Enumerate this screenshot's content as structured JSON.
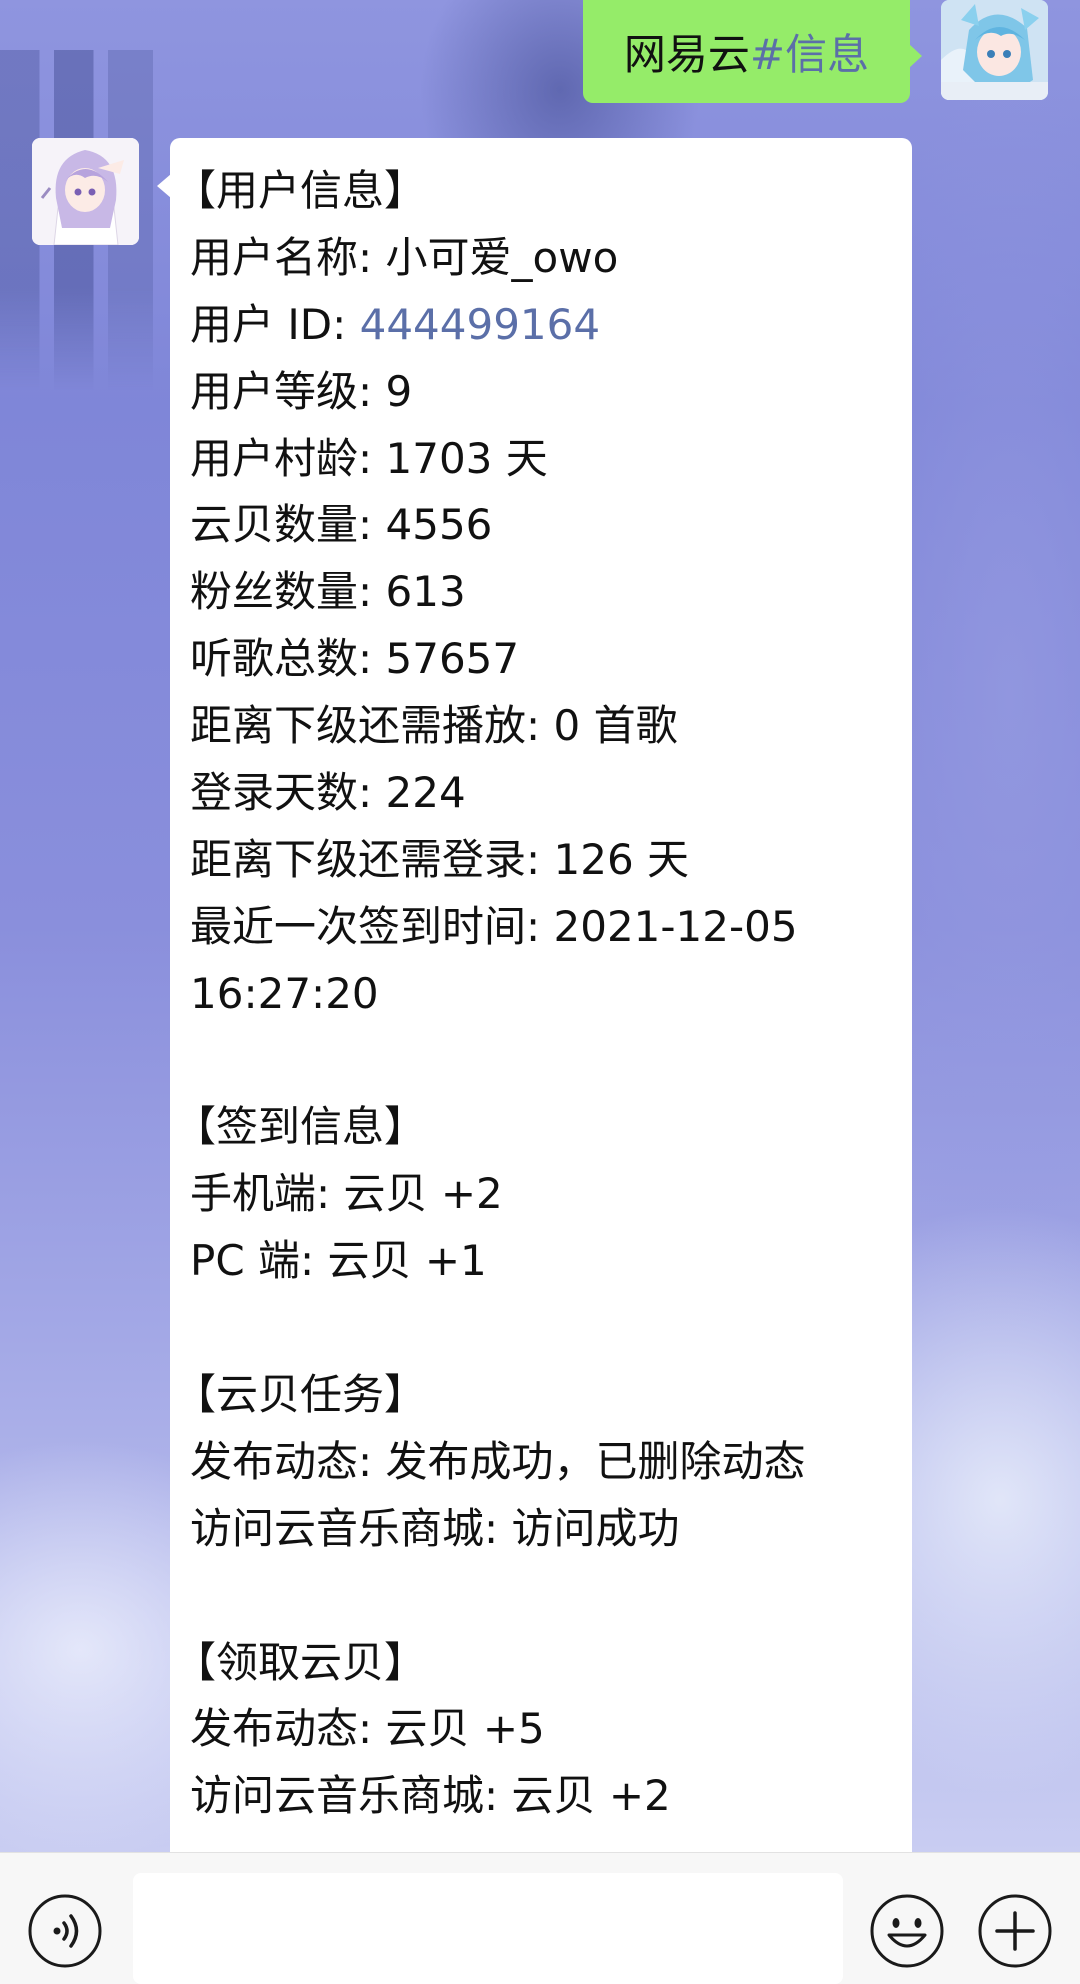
{
  "chat": {
    "outgoing": {
      "prefix": "网易云",
      "hashtag": "#信息"
    },
    "reply": {
      "user_info_header": "【用户信息】",
      "username_label": "用户名称: ",
      "username": "小可爱_owo",
      "user_id_label": "用户 ID: ",
      "user_id": "444499164",
      "level": "用户等级: 9",
      "account_age": "用户村龄: 1703 天",
      "cloud_shells": "云贝数量: 4556",
      "followers": "粉丝数量: 613",
      "total_listens": "听歌总数: 57657",
      "plays_to_next_level": "距离下级还需播放: 0 首歌",
      "login_days": "登录天数: 224",
      "logins_to_next_level": "距离下级还需登录: 126 天",
      "last_checkin_label": "最近一次签到时间: 2021-12-05",
      "last_checkin_time": "16:27:20",
      "checkin_header": "【签到信息】",
      "checkin_mobile": "手机端: 云贝 +2",
      "checkin_pc": "PC 端: 云贝 +1",
      "tasks_header": "【云贝任务】",
      "task_post": "发布动态: 发布成功，已删除动态",
      "task_visit": "访问云音乐商城: 访问成功",
      "claim_header": "【领取云贝】",
      "claim_post": "发布动态: 云贝 +5",
      "claim_visit": "访问云音乐商城: 云贝 +2"
    }
  },
  "input_bar": {
    "voice_icon": "voice-icon",
    "emoji_icon": "emoji-icon",
    "plus_icon": "plus-icon",
    "text_value": ""
  },
  "colors": {
    "outgoing_bubble": "#95ec69",
    "incoming_bubble": "#ffffff",
    "link": "#5b6fa8"
  }
}
